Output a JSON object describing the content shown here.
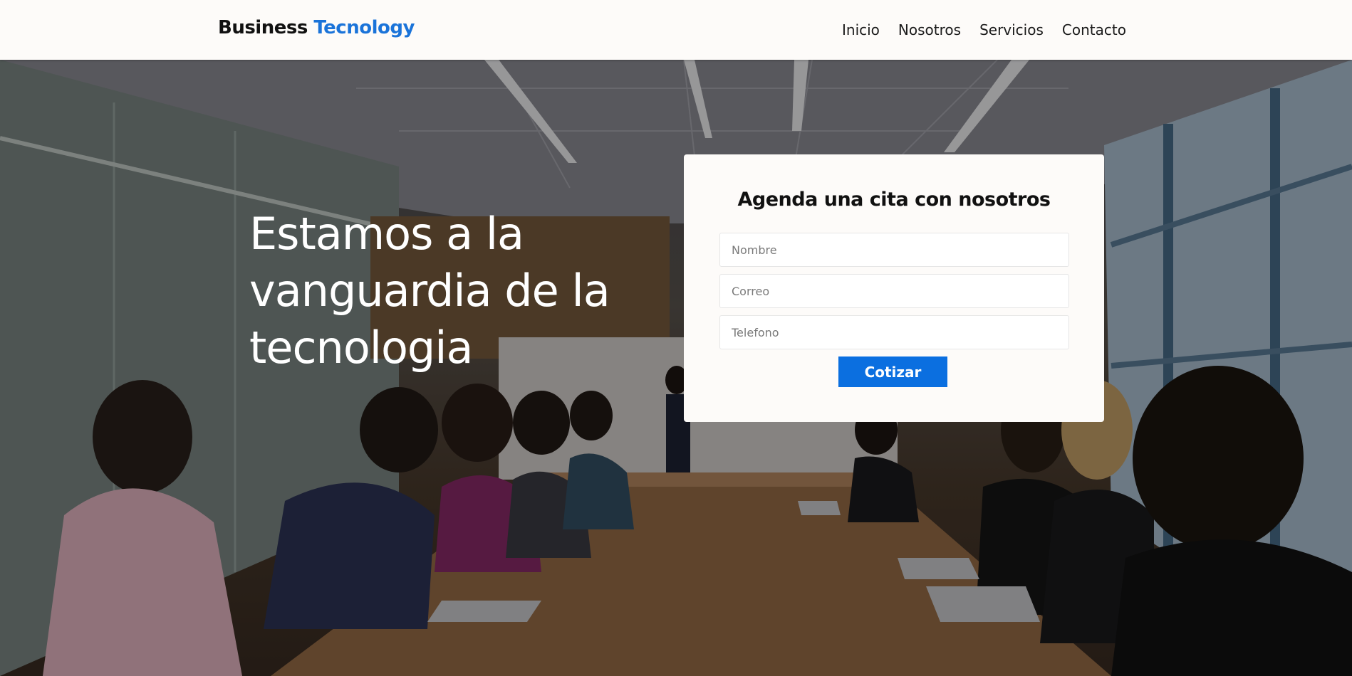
{
  "header": {
    "logo_part1": "Business",
    "logo_part2": "Tecnology",
    "nav": [
      "Inicio",
      "Nosotros",
      "Servicios",
      "Contacto"
    ]
  },
  "hero": {
    "headline": "Estamos a la vanguardia de la tecnologia"
  },
  "form": {
    "title": "Agenda una cita con nosotros",
    "name_placeholder": "Nombre",
    "email_placeholder": "Correo",
    "phone_placeholder": "Telefono",
    "submit_label": "Cotizar"
  },
  "colors": {
    "accent": "#1a73d9",
    "button": "#0b6fe0",
    "header_bg": "#fdfbf9"
  }
}
